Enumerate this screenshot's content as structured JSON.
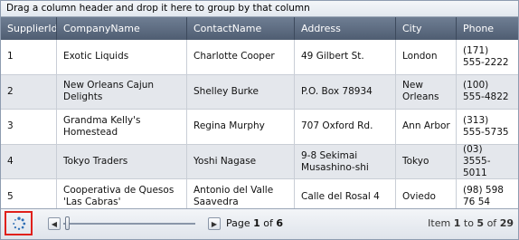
{
  "group_panel": {
    "hint": "Drag a column header and drop it here to group by that column"
  },
  "columns": [
    "SupplierId",
    "CompanyName",
    "ContactName",
    "Address",
    "City",
    "Phone"
  ],
  "rows": [
    {
      "id": "1",
      "company": "Exotic Liquids",
      "contact": "Charlotte Cooper",
      "address": "49 Gilbert St.",
      "city": "London",
      "phone": "(171) 555-2222"
    },
    {
      "id": "2",
      "company": "New Orleans Cajun Delights",
      "contact": "Shelley Burke",
      "address": "P.O. Box 78934",
      "city": "New Orleans",
      "phone": "(100) 555-4822"
    },
    {
      "id": "3",
      "company": "Grandma Kelly's Homestead",
      "contact": "Regina Murphy",
      "address": "707 Oxford Rd.",
      "city": "Ann Arbor",
      "phone": "(313) 555-5735"
    },
    {
      "id": "4",
      "company": "Tokyo Traders",
      "contact": "Yoshi Nagase",
      "address": "9-8 Sekimai Musashino-shi",
      "city": "Tokyo",
      "phone": "(03) 3555-5011"
    },
    {
      "id": "5",
      "company": "Cooperativa de Quesos 'Las Cabras'",
      "contact": "Antonio del Valle Saavedra",
      "address": "Calle del Rosal 4",
      "city": "Oviedo",
      "phone": "(98) 598 76 54"
    }
  ],
  "pager": {
    "page_word": "Page",
    "current_page": "1",
    "of_word": "of",
    "total_pages": "6",
    "item_word": "Item",
    "item_from": "1",
    "to_word": "to",
    "item_to": "5",
    "total_items": "29",
    "refresh_icon": "refresh-icon",
    "slider_fraction": 0.0,
    "highlight_color": "#e0201b"
  },
  "colors": {
    "header_bg": "#5a687c",
    "alt_row_bg": "#e4e7ec"
  }
}
